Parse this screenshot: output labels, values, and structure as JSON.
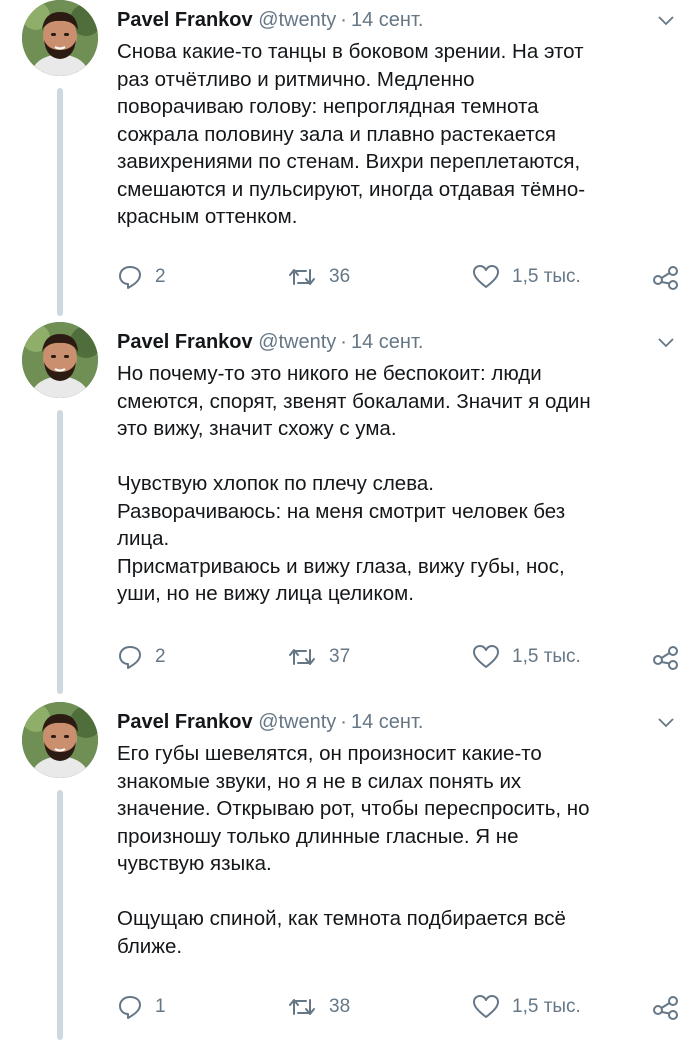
{
  "tweets": [
    {
      "author": "Pavel Frankov",
      "handle": "@twenty",
      "separator": "·",
      "date": "14 сент.",
      "paragraphs": [
        [
          "Снова какие-то танцы в боковом зрении. На этот",
          "раз отчётливо и ритмично. Медленно",
          "поворачиваю голову: непроглядная темнота",
          "сожрала половину зала и плавно растекается",
          "завихрениями по стенам. Вихри переплетаются,",
          "смешаются и пульсируют, иногда отдавая тёмно-",
          "красным оттенком."
        ]
      ],
      "replies": "2",
      "retweets": "36",
      "likes": "1,5 тыс."
    },
    {
      "author": "Pavel Frankov",
      "handle": "@twenty",
      "separator": "·",
      "date": "14 сент.",
      "paragraphs": [
        [
          "Но почему-то это никого не беспокоит: люди",
          "смеются, спорят, звенят бокалами. Значит я один",
          "это вижу, значит схожу с ума."
        ],
        [
          "Чувствую хлопок по плечу слева.",
          "Разворачиваюсь: на меня смотрит человек без",
          "лица.",
          "Присматриваюсь и вижу глаза, вижу губы, нос,",
          "уши, но не вижу лица целиком."
        ]
      ],
      "replies": "2",
      "retweets": "37",
      "likes": "1,5 тыс."
    },
    {
      "author": "Pavel Frankov",
      "handle": "@twenty",
      "separator": "·",
      "date": "14 сент.",
      "paragraphs": [
        [
          "Его губы шевелятся, он произносит какие-то",
          "знакомые звуки, но я не в силах понять их",
          "значение. Открываю рот, чтобы переспросить, но",
          "произношу только длинные гласные. Я не",
          "чувствую языка."
        ],
        [
          "Ощущаю спиной, как темнота подбирается всё",
          "ближе."
        ]
      ],
      "replies": "1",
      "retweets": "38",
      "likes": "1,5 тыс."
    }
  ],
  "icons": {
    "reply": "reply-icon",
    "retweet": "retweet-icon",
    "like": "heart-icon",
    "share": "share-icon",
    "menu": "chevron-down-icon"
  },
  "colors": {
    "text": "#14171a",
    "secondary": "#657786",
    "thread_line": "#cdd8e1",
    "background": "#ffffff"
  }
}
